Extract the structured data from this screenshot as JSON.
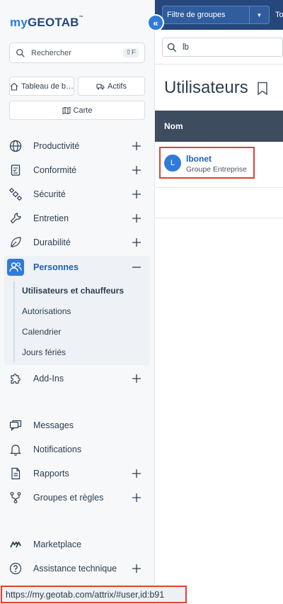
{
  "logo": {
    "my": "my",
    "brand": "GEOTAB",
    "tm": "™"
  },
  "sidebar": {
    "search": {
      "placeholder": "Rechercher",
      "shortcut": "⇧F"
    },
    "quick": [
      {
        "label": "Tableau de b…",
        "icon": "home-icon"
      },
      {
        "label": "Actifs",
        "icon": "truck-icon"
      },
      {
        "label": "Carte",
        "icon": "map-icon"
      }
    ],
    "items": [
      {
        "label": "Productivité",
        "icon": "globe-icon",
        "expand": "+"
      },
      {
        "label": "Conformité",
        "icon": "clipboard-icon",
        "expand": "+"
      },
      {
        "label": "Sécurité",
        "icon": "satellite-icon",
        "expand": "+"
      },
      {
        "label": "Entretien",
        "icon": "wrench-icon",
        "expand": "+"
      },
      {
        "label": "Durabilité",
        "icon": "leaf-icon",
        "expand": "+"
      },
      {
        "label": "Personnes",
        "icon": "people-icon",
        "expand": "−"
      },
      {
        "label": "Add-Ins",
        "icon": "puzzle-icon",
        "expand": "+"
      },
      {
        "label": "Messages",
        "icon": "messages-icon"
      },
      {
        "label": "Notifications",
        "icon": "bell-icon"
      },
      {
        "label": "Rapports",
        "icon": "report-icon",
        "expand": "+"
      },
      {
        "label": "Groupes et règles",
        "icon": "rules-icon",
        "expand": "+"
      },
      {
        "label": "Marketplace",
        "icon": "marketplace-icon"
      },
      {
        "label": "Assistance technique",
        "icon": "help-icon",
        "expand": "+"
      }
    ],
    "personnes_sub": [
      "Utilisateurs et chauffeurs",
      "Autorisations",
      "Calendrier",
      "Jours fériés"
    ]
  },
  "topbar": {
    "group_filter": "Filtre de groupes",
    "truncated": "To"
  },
  "main": {
    "search_value": "lb",
    "title": "Utilisateurs",
    "column": "Nom",
    "rows": [
      {
        "avatar": "L",
        "name": "lbonet",
        "group": "Groupe Entreprise"
      }
    ]
  },
  "status_url": "https://my.geotab.com/attrix/#user,id:b91",
  "colors": {
    "accent": "#2f7bd9",
    "nav_dark": "#25477b",
    "header": "#3d4c5f",
    "highlight": "#e0412e"
  }
}
